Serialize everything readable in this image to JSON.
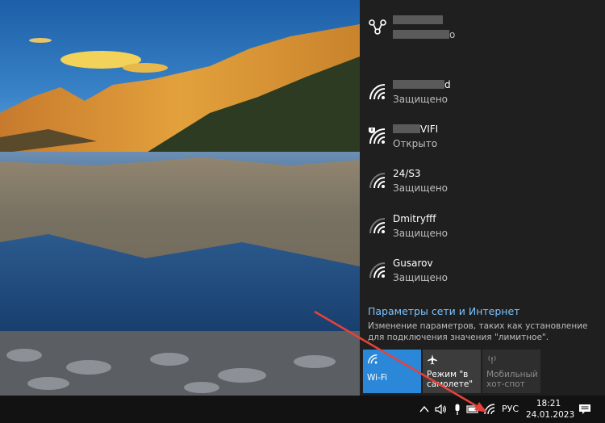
{
  "networks": [
    {
      "name_suffix": "о",
      "status": ""
    },
    {
      "name_suffix": "d",
      "status": "Защищено"
    },
    {
      "name_suffix": "VIFI",
      "status": "Открыто"
    },
    {
      "name": "24/S3",
      "status": "Защищено"
    },
    {
      "name": "Dmitryfff",
      "status": "Защищено"
    },
    {
      "name": "Gusarov",
      "status": "Защищено"
    }
  ],
  "settings": {
    "link": "Параметры сети и Интернет",
    "description": "Изменение параметров, таких как установление для подключения значения \"лимитное\"."
  },
  "tiles": {
    "wifi": "Wi-Fi",
    "airplane": "Режим \"в самолете\"",
    "hotspot": "Мобильный хот-спот"
  },
  "taskbar": {
    "language": "РУС",
    "time": "18:21",
    "date": "24.01.2023"
  },
  "colors": {
    "flyout_bg": "#1f1f1f",
    "accent": "#2b88d8",
    "link": "#7cc3ff",
    "arrow": "#e8413a"
  },
  "icons": [
    "network-hub-icon",
    "wifi-icon",
    "wifi-secured-warning-icon",
    "airplane-icon",
    "hotspot-icon",
    "chevron-up-icon",
    "speaker-icon",
    "microphone-icon",
    "battery-icon",
    "notification-icon"
  ]
}
